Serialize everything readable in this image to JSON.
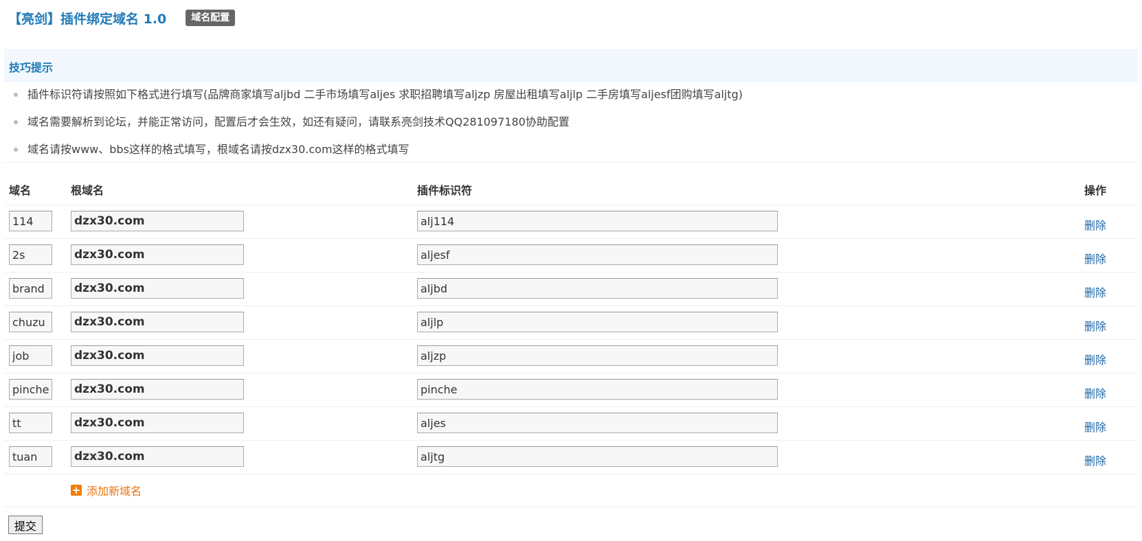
{
  "header": {
    "title": "【亮剑】插件绑定域名 1.0",
    "badge": "域名配置"
  },
  "tips": {
    "heading": "技巧提示",
    "items": [
      "插件标识符请按照如下格式进行填写(品牌商家填写aljbd 二手市场填写aljes 求职招聘填写aljzp 房屋出租填写aljlp 二手房填写aljesf团购填写aljtg)",
      "域名需要解析到论坛，并能正常访问，配置后才会生效，如还有疑问，请联系亮剑技术QQ281097180协助配置",
      "域名请按www、bbs这样的格式填写，根域名请按dzx30.com这样的格式填写"
    ]
  },
  "table": {
    "headers": {
      "domain": "域名",
      "root": "根域名",
      "plugin": "插件标识符",
      "action": "操作"
    },
    "rows": [
      {
        "domain": "114",
        "root": "dzx30.com",
        "plugin": "alj114",
        "delete": "删除"
      },
      {
        "domain": "2s",
        "root": "dzx30.com",
        "plugin": "aljesf",
        "delete": "删除"
      },
      {
        "domain": "brand",
        "root": "dzx30.com",
        "plugin": "aljbd",
        "delete": "删除"
      },
      {
        "domain": "chuzu",
        "root": "dzx30.com",
        "plugin": "aljlp",
        "delete": "删除"
      },
      {
        "domain": "job",
        "root": "dzx30.com",
        "plugin": "aljzp",
        "delete": "删除"
      },
      {
        "domain": "pinche",
        "root": "dzx30.com",
        "plugin": "pinche",
        "delete": "删除"
      },
      {
        "domain": "tt",
        "root": "dzx30.com",
        "plugin": "aljes",
        "delete": "删除"
      },
      {
        "domain": "tuan",
        "root": "dzx30.com",
        "plugin": "aljtg",
        "delete": "删除"
      }
    ],
    "add_label": "添加新域名"
  },
  "submit_label": "提交",
  "colors": {
    "accent": "#1f7ab6",
    "add": "#e87410",
    "tips_bg": "#f2f8fe"
  }
}
